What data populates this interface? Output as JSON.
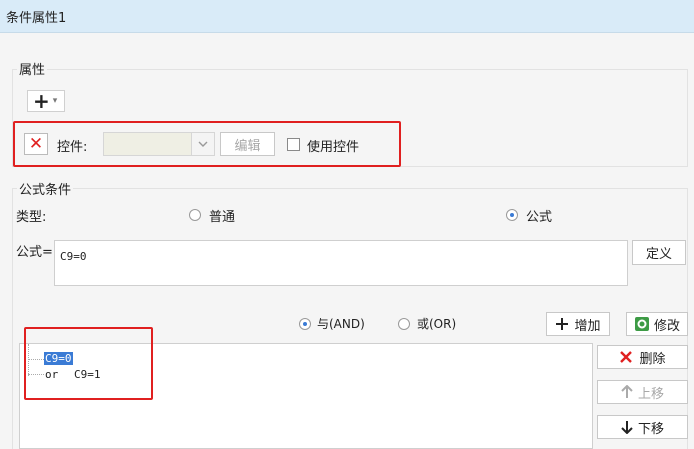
{
  "window": {
    "title": "条件属性1"
  },
  "properties": {
    "section_label": "属性",
    "add_button_symbol": "+",
    "add_dropdown_symbol": "▾",
    "remove_icon_symbol": "✕",
    "control_label": "控件:",
    "edit_button": "编辑",
    "use_control_label": "使用控件"
  },
  "formula_condition": {
    "section_label": "公式条件",
    "type_label": "类型:",
    "type_options": [
      "普通",
      "公式"
    ],
    "type_selected": "公式",
    "formula_label": "公式=",
    "formula_value": "C9=0",
    "define_button": "定义",
    "logic_options": [
      "与(AND)",
      "或(OR)"
    ],
    "logic_selected": "与(AND)",
    "add_button": "增加",
    "modify_button": "修改",
    "delete_button": "删除",
    "move_up_button": "上移",
    "move_down_button": "下移",
    "conditions": [
      {
        "prefix": "",
        "text": "C9=0",
        "selected": true
      },
      {
        "prefix": "or",
        "text": "C9=1",
        "selected": false
      }
    ]
  },
  "colors": {
    "highlight_box": "#e02020",
    "selection": "#3a7bd5",
    "title_bg": "#d9ebf8"
  }
}
